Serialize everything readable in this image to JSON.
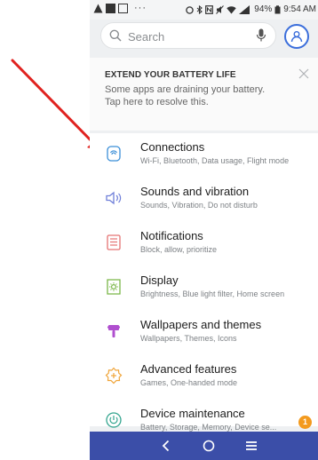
{
  "status_bar": {
    "dots": "···",
    "battery": "94%",
    "time": "9:54 AM"
  },
  "search": {
    "placeholder": "Search"
  },
  "tip": {
    "title": "EXTEND YOUR BATTERY LIFE",
    "text": "Some apps are draining your battery. Tap here to resolve this."
  },
  "items": [
    {
      "title": "Connections",
      "subtitle": "Wi-Fi, Bluetooth, Data usage, Flight mode",
      "icon": "connections-icon"
    },
    {
      "title": "Sounds and vibration",
      "subtitle": "Sounds, Vibration, Do not disturb",
      "icon": "speaker-icon"
    },
    {
      "title": "Notifications",
      "subtitle": "Block, allow, prioritize",
      "icon": "notifications-icon"
    },
    {
      "title": "Display",
      "subtitle": "Brightness, Blue light filter, Home screen",
      "icon": "display-icon"
    },
    {
      "title": "Wallpapers and themes",
      "subtitle": "Wallpapers, Themes, Icons",
      "icon": "wallpaper-icon"
    },
    {
      "title": "Advanced features",
      "subtitle": "Games, One-handed mode",
      "icon": "advanced-features-icon"
    },
    {
      "title": "Device maintenance",
      "subtitle": "Battery, Storage, Memory, Device se...",
      "icon": "device-maintenance-icon",
      "badge": "1"
    }
  ],
  "colors": {
    "nav_bar": "#3b4ea8",
    "arrow": "#e0221f",
    "accent": "#3b6edb",
    "badge": "#f39a1e"
  }
}
